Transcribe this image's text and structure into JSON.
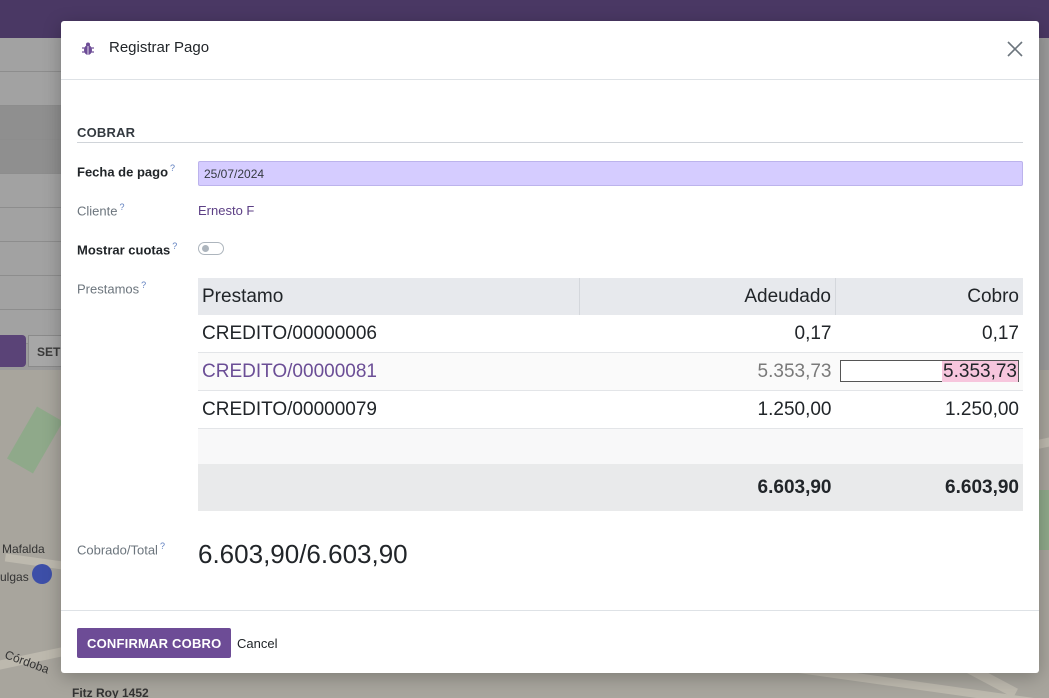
{
  "background": {
    "set_button_label": "SET",
    "map_labels": [
      "Mafalda",
      "ulgas",
      "Córdoba",
      "Fitz Roy 1452"
    ]
  },
  "dialog": {
    "title": "Registrar Pago",
    "section_title": "COBRAR",
    "fields": {
      "payment_date": {
        "label": "Fecha de pago",
        "help": "?",
        "value": "25/07/2024"
      },
      "client": {
        "label": "Cliente",
        "help": "?",
        "value": "Ernesto F"
      },
      "show_installments": {
        "label": "Mostrar cuotas",
        "help": "?",
        "checked": false
      },
      "loans": {
        "label": "Prestamos",
        "help": "?"
      }
    },
    "table": {
      "headers": [
        "Prestamo",
        "Adeudado",
        "Cobro"
      ],
      "rows": [
        {
          "loan": "CREDITO/00000006",
          "owed": "0,17",
          "charge": "0,17"
        },
        {
          "loan": "CREDITO/00000081",
          "owed": "5.353,73",
          "charge": "5.353,73"
        },
        {
          "loan": "CREDITO/00000079",
          "owed": "1.250,00",
          "charge": "1.250,00"
        }
      ],
      "totals": {
        "owed": "6.603,90",
        "charge": "6.603,90"
      }
    },
    "collected_total": {
      "label": "Cobrado/Total",
      "help": "?",
      "value": "6.603,90/6.603,90"
    },
    "footer": {
      "confirm_label": "CONFIRMAR COBRO",
      "cancel_label": "Cancel"
    }
  },
  "colors": {
    "brand": "#6d4c96",
    "date_field": "#d5ccff",
    "link": "#5c3f85"
  }
}
